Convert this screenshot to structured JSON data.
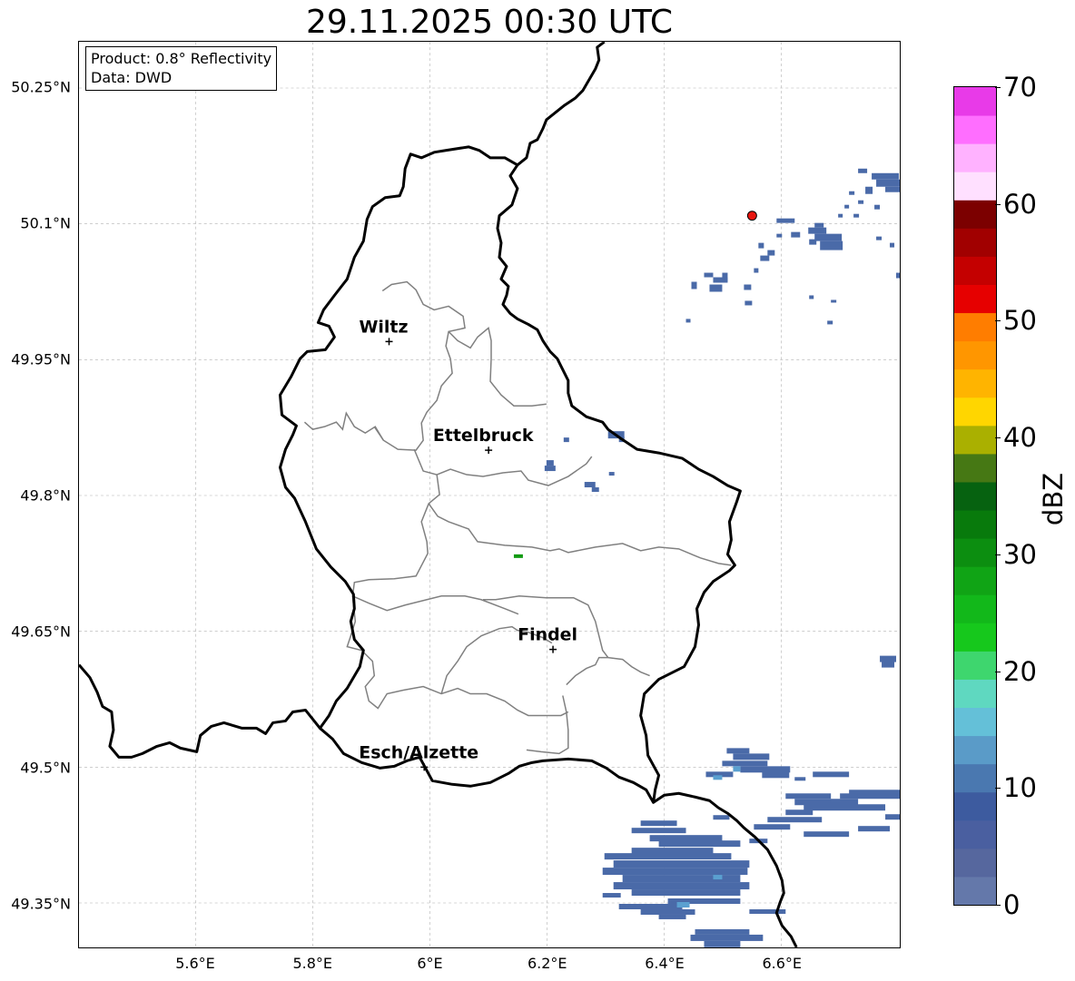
{
  "title": "29.11.2025 00:30 UTC",
  "info": {
    "product": "Product: 0.8° Reflectivity",
    "source": "Data: DWD"
  },
  "axes": {
    "lon_ticks": [
      "5.6°E",
      "5.8°E",
      "6°E",
      "6.2°E",
      "6.4°E",
      "6.6°E"
    ],
    "lat_ticks": [
      "50.25°N",
      "50.1°N",
      "49.95°N",
      "49.8°N",
      "49.65°N",
      "49.5°N",
      "49.35°N"
    ],
    "grid": true
  },
  "cities": [
    {
      "name": "Wiltz",
      "lon": 5.93,
      "lat": 49.97
    },
    {
      "name": "Ettelbruck",
      "lon": 6.1,
      "lat": 49.85
    },
    {
      "name": "Findel",
      "lon": 6.21,
      "lat": 49.63
    },
    {
      "name": "Esch/Alzette",
      "lon": 5.99,
      "lat": 49.5
    }
  ],
  "radar_site": {
    "lon": 6.55,
    "lat": 50.11,
    "color": "#e8150f"
  },
  "colorbar": {
    "label": "dBZ",
    "min": 0,
    "max": 70,
    "ticks": [
      "0",
      "10",
      "20",
      "30",
      "40",
      "50",
      "60",
      "70"
    ],
    "colors": [
      "#6478aa",
      "#56679e",
      "#4a5fa0",
      "#3d5b9f",
      "#4a78b0",
      "#5a9bc8",
      "#64c0d8",
      "#5fd8c0",
      "#3ed66e",
      "#16c81c",
      "#12b81a",
      "#10a415",
      "#0c8e10",
      "#087a0c",
      "#066210",
      "#467814",
      "#aab000",
      "#ffd600",
      "#ffb400",
      "#ff9600",
      "#ff7d00",
      "#e60000",
      "#c40000",
      "#a10000",
      "#7c0000",
      "#ffe0ff",
      "#ffb2ff",
      "#ff6eff",
      "#e83ae8"
    ]
  },
  "colors": {
    "border": "#000000",
    "district": "#808080",
    "grid": "#b0b0b0",
    "echo_weak": "#4a6aa8",
    "echo_light": "#5aa0d0",
    "echo_green": "#119a12"
  }
}
